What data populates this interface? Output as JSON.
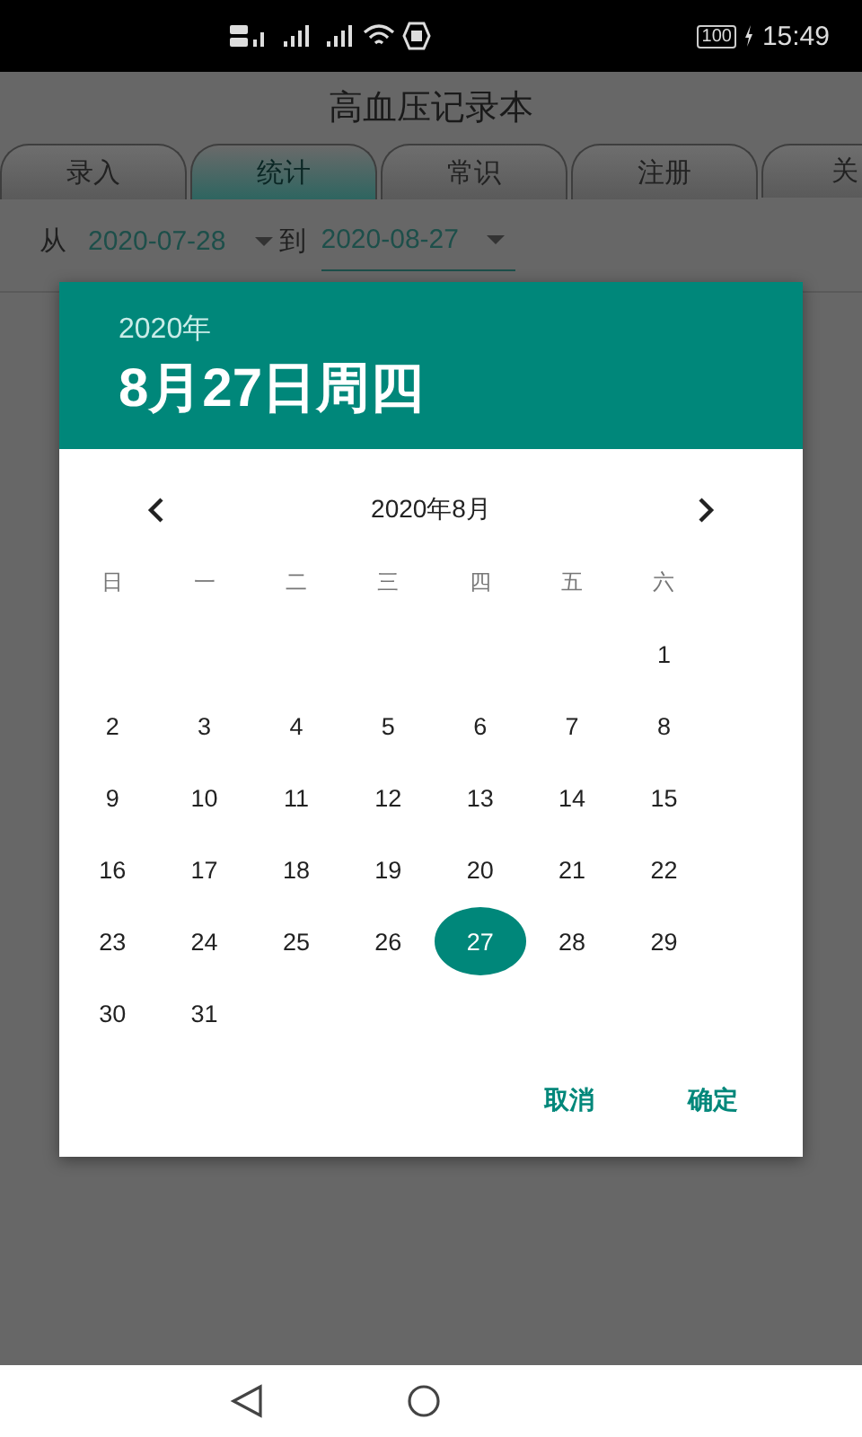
{
  "status_bar": {
    "battery": "100",
    "time": "15:49"
  },
  "app": {
    "title": "高血压记录本",
    "tabs": [
      {
        "label": "录入",
        "selected": false
      },
      {
        "label": "统计",
        "selected": true
      },
      {
        "label": "常识",
        "selected": false
      },
      {
        "label": "注册",
        "selected": false
      },
      {
        "label": "关",
        "selected": false
      }
    ],
    "date_range": {
      "from_label": "从",
      "from": "2020-07-28",
      "to_label": "到",
      "to": "2020-08-27"
    }
  },
  "date_picker": {
    "year": "2020年",
    "date": "8月27日周四",
    "month": "2020年8月",
    "weekdays": [
      "日",
      "一",
      "二",
      "三",
      "四",
      "五",
      "六"
    ],
    "days": [
      {
        "kind": "blank"
      },
      {
        "kind": "blank"
      },
      {
        "kind": "blank"
      },
      {
        "kind": "blank"
      },
      {
        "kind": "blank"
      },
      {
        "kind": "blank"
      },
      {
        "kind": "day",
        "label": "1",
        "selected": false
      },
      {
        "kind": "day",
        "label": "2",
        "selected": false
      },
      {
        "kind": "day",
        "label": "3",
        "selected": false
      },
      {
        "kind": "day",
        "label": "4",
        "selected": false
      },
      {
        "kind": "day",
        "label": "5",
        "selected": false
      },
      {
        "kind": "day",
        "label": "6",
        "selected": false
      },
      {
        "kind": "day",
        "label": "7",
        "selected": false
      },
      {
        "kind": "day",
        "label": "8",
        "selected": false
      },
      {
        "kind": "day",
        "label": "9",
        "selected": false
      },
      {
        "kind": "day",
        "label": "10",
        "selected": false
      },
      {
        "kind": "day",
        "label": "11",
        "selected": false
      },
      {
        "kind": "day",
        "label": "12",
        "selected": false
      },
      {
        "kind": "day",
        "label": "13",
        "selected": false
      },
      {
        "kind": "day",
        "label": "14",
        "selected": false
      },
      {
        "kind": "day",
        "label": "15",
        "selected": false
      },
      {
        "kind": "day",
        "label": "16",
        "selected": false
      },
      {
        "kind": "day",
        "label": "17",
        "selected": false
      },
      {
        "kind": "day",
        "label": "18",
        "selected": false
      },
      {
        "kind": "day",
        "label": "19",
        "selected": false
      },
      {
        "kind": "day",
        "label": "20",
        "selected": false
      },
      {
        "kind": "day",
        "label": "21",
        "selected": false
      },
      {
        "kind": "day",
        "label": "22",
        "selected": false
      },
      {
        "kind": "day",
        "label": "23",
        "selected": false
      },
      {
        "kind": "day",
        "label": "24",
        "selected": false
      },
      {
        "kind": "day",
        "label": "25",
        "selected": false
      },
      {
        "kind": "day",
        "label": "26",
        "selected": false
      },
      {
        "kind": "day",
        "label": "27",
        "selected": true
      },
      {
        "kind": "day",
        "label": "28",
        "selected": false
      },
      {
        "kind": "day",
        "label": "29",
        "selected": false
      },
      {
        "kind": "day",
        "label": "30",
        "selected": false
      },
      {
        "kind": "day",
        "label": "31",
        "selected": false
      }
    ],
    "buttons": [
      "取消",
      "确定"
    ]
  }
}
